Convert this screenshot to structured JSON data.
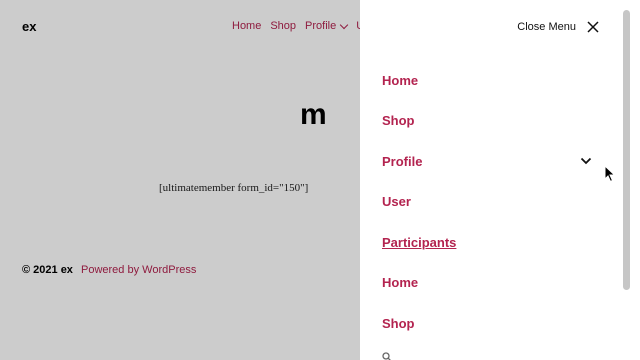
{
  "site": {
    "title": "ex"
  },
  "top_nav": {
    "items": [
      "Home",
      "Shop",
      "Profile",
      "Us"
    ]
  },
  "page": {
    "heading": "m",
    "shortcode": "[ultimatemember form_id=\"150\"]"
  },
  "footer": {
    "copyright": "© 2021 ex",
    "powered": "Powered by WordPress"
  },
  "menu": {
    "close_label": "Close Menu",
    "items": [
      {
        "label": "Home"
      },
      {
        "label": "Shop"
      },
      {
        "label": "Profile",
        "has_submenu": true
      },
      {
        "label": "User"
      },
      {
        "label": "Participants",
        "active": true
      },
      {
        "label": "Home"
      },
      {
        "label": "Shop"
      }
    ]
  },
  "colors": {
    "accent": "#b3234f",
    "overlay": "rgba(0,0,0,0.2)"
  }
}
